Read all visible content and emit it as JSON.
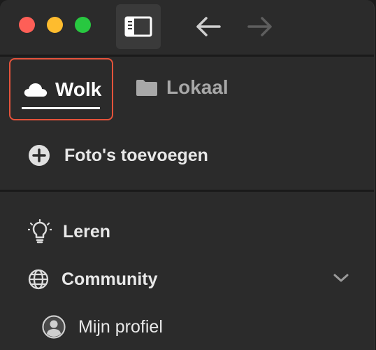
{
  "window": {
    "traffic_lights": [
      "close",
      "minimize",
      "zoom"
    ]
  },
  "toolbar": {
    "sidebar_toggle_icon": "sidebar-icon",
    "back_icon": "arrow-left-icon",
    "forward_icon": "arrow-right-icon"
  },
  "tabs": [
    {
      "label": "Wolk",
      "icon": "cloud-icon",
      "selected": true
    },
    {
      "label": "Lokaal",
      "icon": "folder-icon",
      "selected": false
    }
  ],
  "actions": {
    "add_photos": {
      "label": "Foto's toevoegen",
      "icon": "plus-circle-icon"
    }
  },
  "menu": {
    "learn": {
      "label": "Leren",
      "icon": "lightbulb-icon"
    },
    "community": {
      "label": "Community",
      "icon": "globe-icon",
      "expanded": false
    },
    "profile": {
      "label": "Mijn profiel",
      "icon": "user-circle-icon"
    }
  },
  "colors": {
    "highlight": "#e5533b",
    "background": "#2b2b2b"
  }
}
